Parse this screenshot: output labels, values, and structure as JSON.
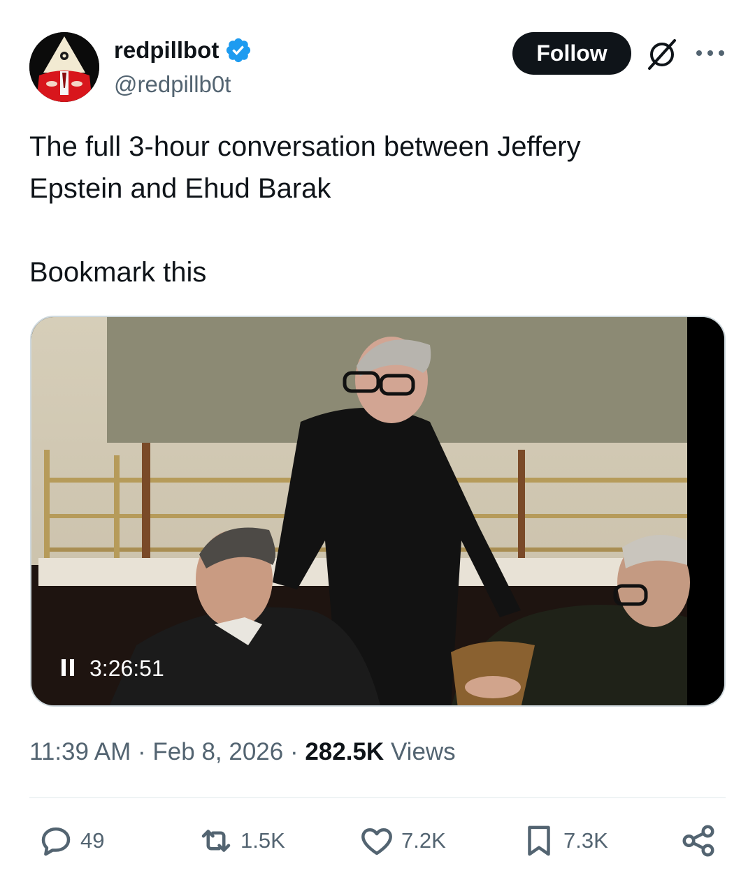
{
  "author": {
    "display_name": "redpillbot",
    "handle": "@redpillb0t",
    "verified_color": "#1d9bf0"
  },
  "header": {
    "follow_label": "Follow",
    "icons": [
      "grok-icon",
      "more-icon"
    ]
  },
  "tweet": {
    "text": "The full 3-hour conversation between Jeffery\nEpstein and Ehud Barak\n\nBookmark this"
  },
  "video": {
    "timecode": "3:26:51",
    "state_icon": "pause-icon"
  },
  "meta": {
    "time": "11:39 AM",
    "date": "Feb 8, 2026",
    "separator": "·",
    "views_count": "282.5K",
    "views_label": "Views"
  },
  "actions": {
    "replies": "49",
    "reposts": "1.5K",
    "likes": "7.2K",
    "bookmarks": "7.3K"
  },
  "colors": {
    "text_primary": "#0f1419",
    "text_secondary": "#536471",
    "follow_bg": "#0f1419",
    "verified": "#1d9bf0"
  }
}
